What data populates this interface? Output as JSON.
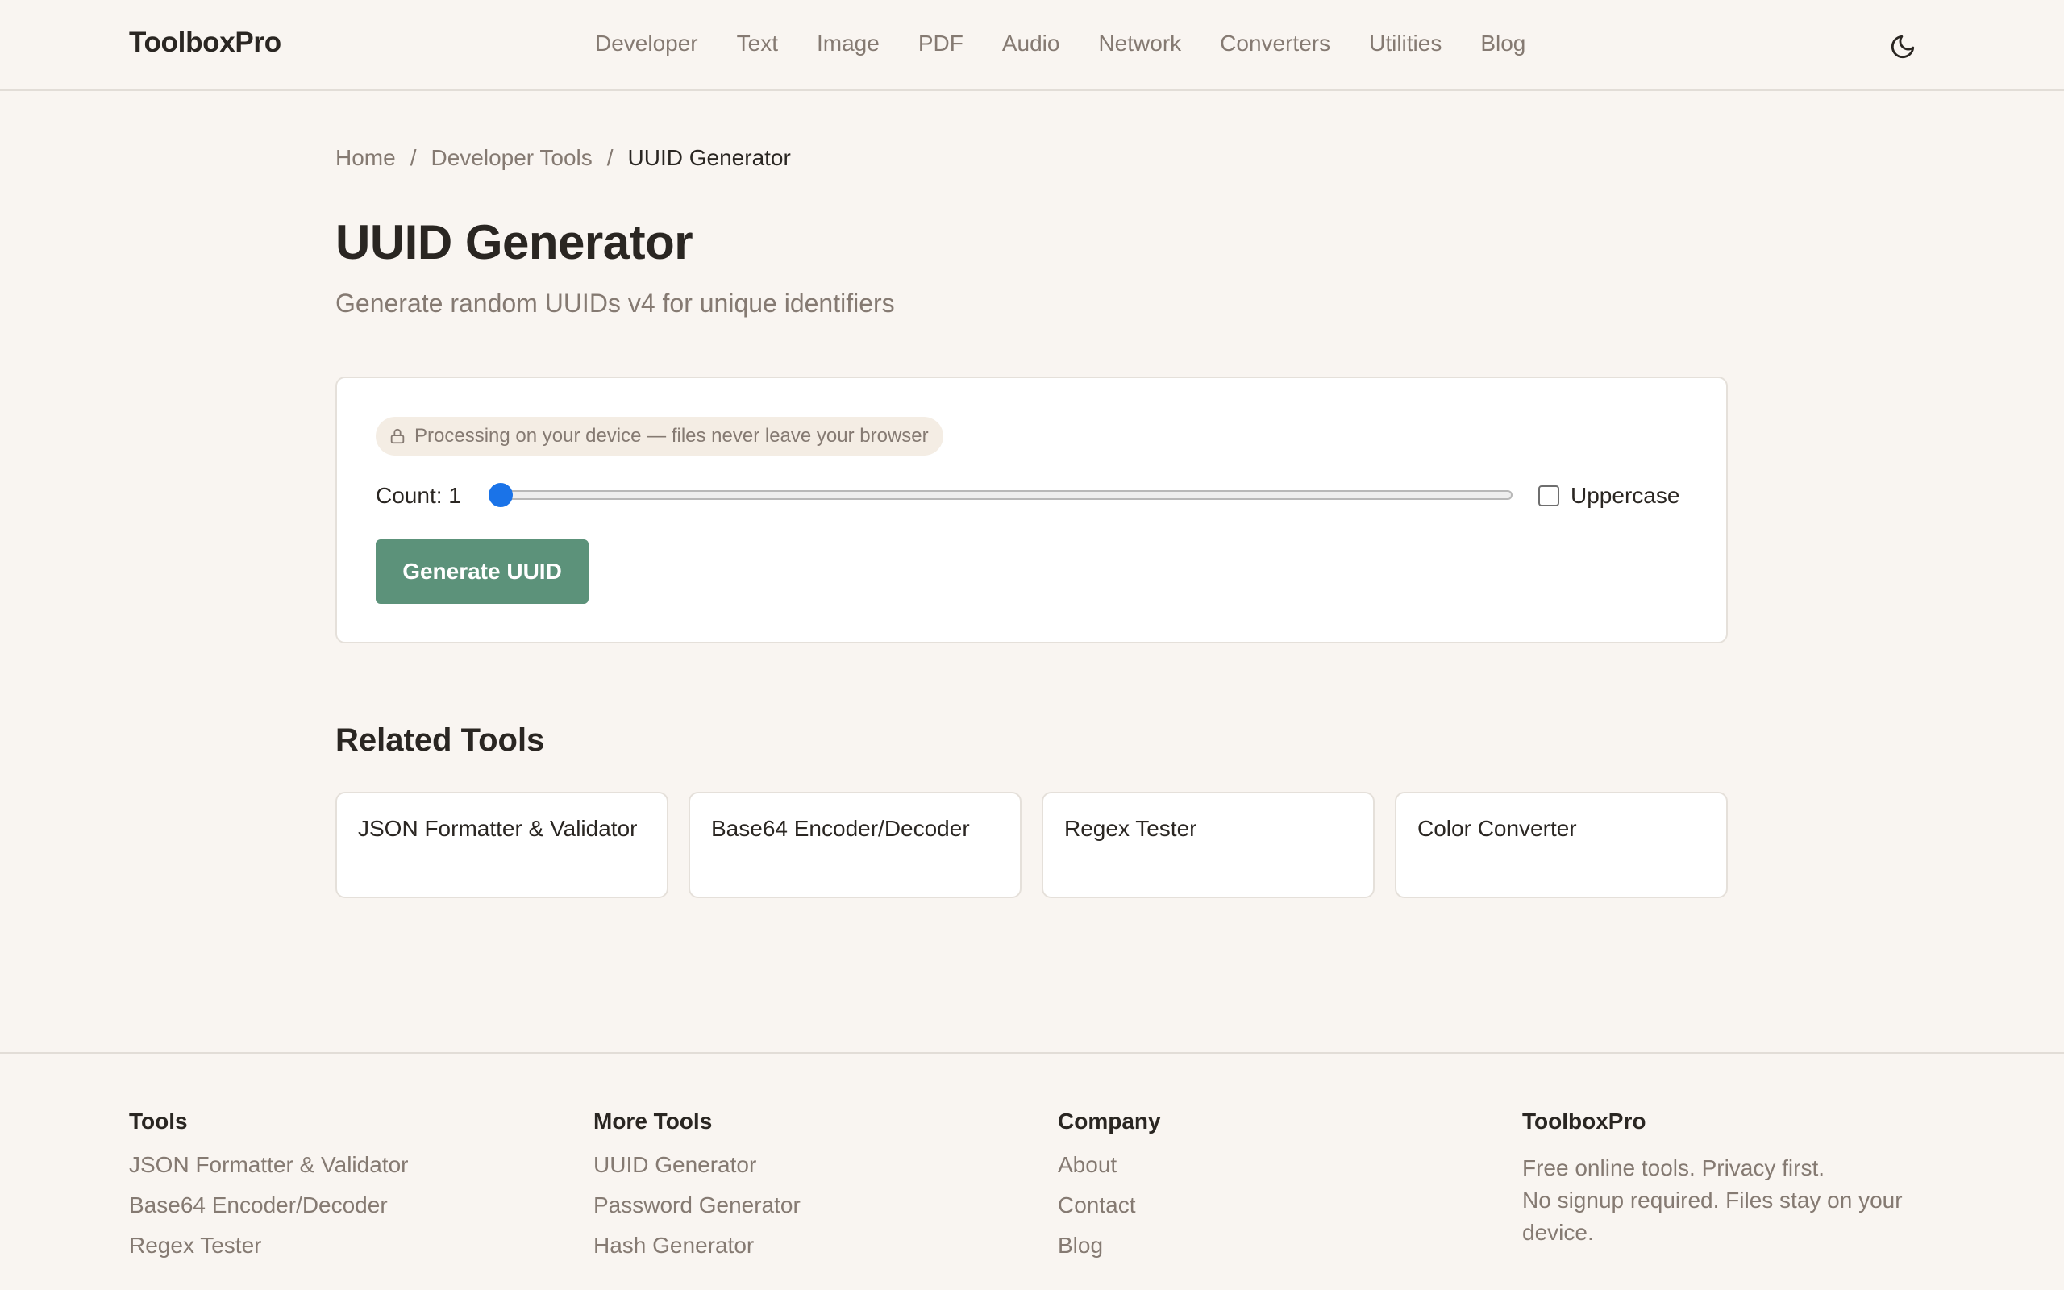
{
  "header": {
    "brand": "ToolboxPro",
    "nav": [
      "Developer",
      "Text",
      "Image",
      "PDF",
      "Audio",
      "Network",
      "Converters",
      "Utilities",
      "Blog"
    ],
    "theme_icon": "moon-icon"
  },
  "breadcrumb": {
    "home": "Home",
    "separator": "/",
    "section": "Developer Tools",
    "current": "UUID Generator"
  },
  "page": {
    "title": "UUID Generator",
    "subtitle": "Generate random UUIDs v4 for unique identifiers"
  },
  "tool": {
    "privacy_badge": "Processing on your device — files never leave your browser",
    "privacy_icon": "lock-icon",
    "count_label": "Count: 1",
    "count_value": 1,
    "uppercase_label": "Uppercase",
    "uppercase_checked": false,
    "generate_label": "Generate UUID"
  },
  "related": {
    "title": "Related Tools",
    "items": [
      "JSON Formatter & Validator",
      "Base64 Encoder/Decoder",
      "Regex Tester",
      "Color Converter"
    ]
  },
  "footer": {
    "tools": {
      "heading": "Tools",
      "links": [
        "JSON Formatter & Validator",
        "Base64 Encoder/Decoder",
        "Regex Tester"
      ]
    },
    "more_tools": {
      "heading": "More Tools",
      "links": [
        "UUID Generator",
        "Password Generator",
        "Hash Generator"
      ]
    },
    "company": {
      "heading": "Company",
      "links": [
        "About",
        "Contact",
        "Blog"
      ]
    },
    "about": {
      "heading": "ToolboxPro",
      "line1": "Free online tools. Privacy first.",
      "line2": "No signup required. Files stay on your device."
    }
  },
  "colors": {
    "background": "#f9f5f1",
    "accent": "#5c927a",
    "slider_thumb": "#1a73e8",
    "muted_text": "#857a72"
  }
}
